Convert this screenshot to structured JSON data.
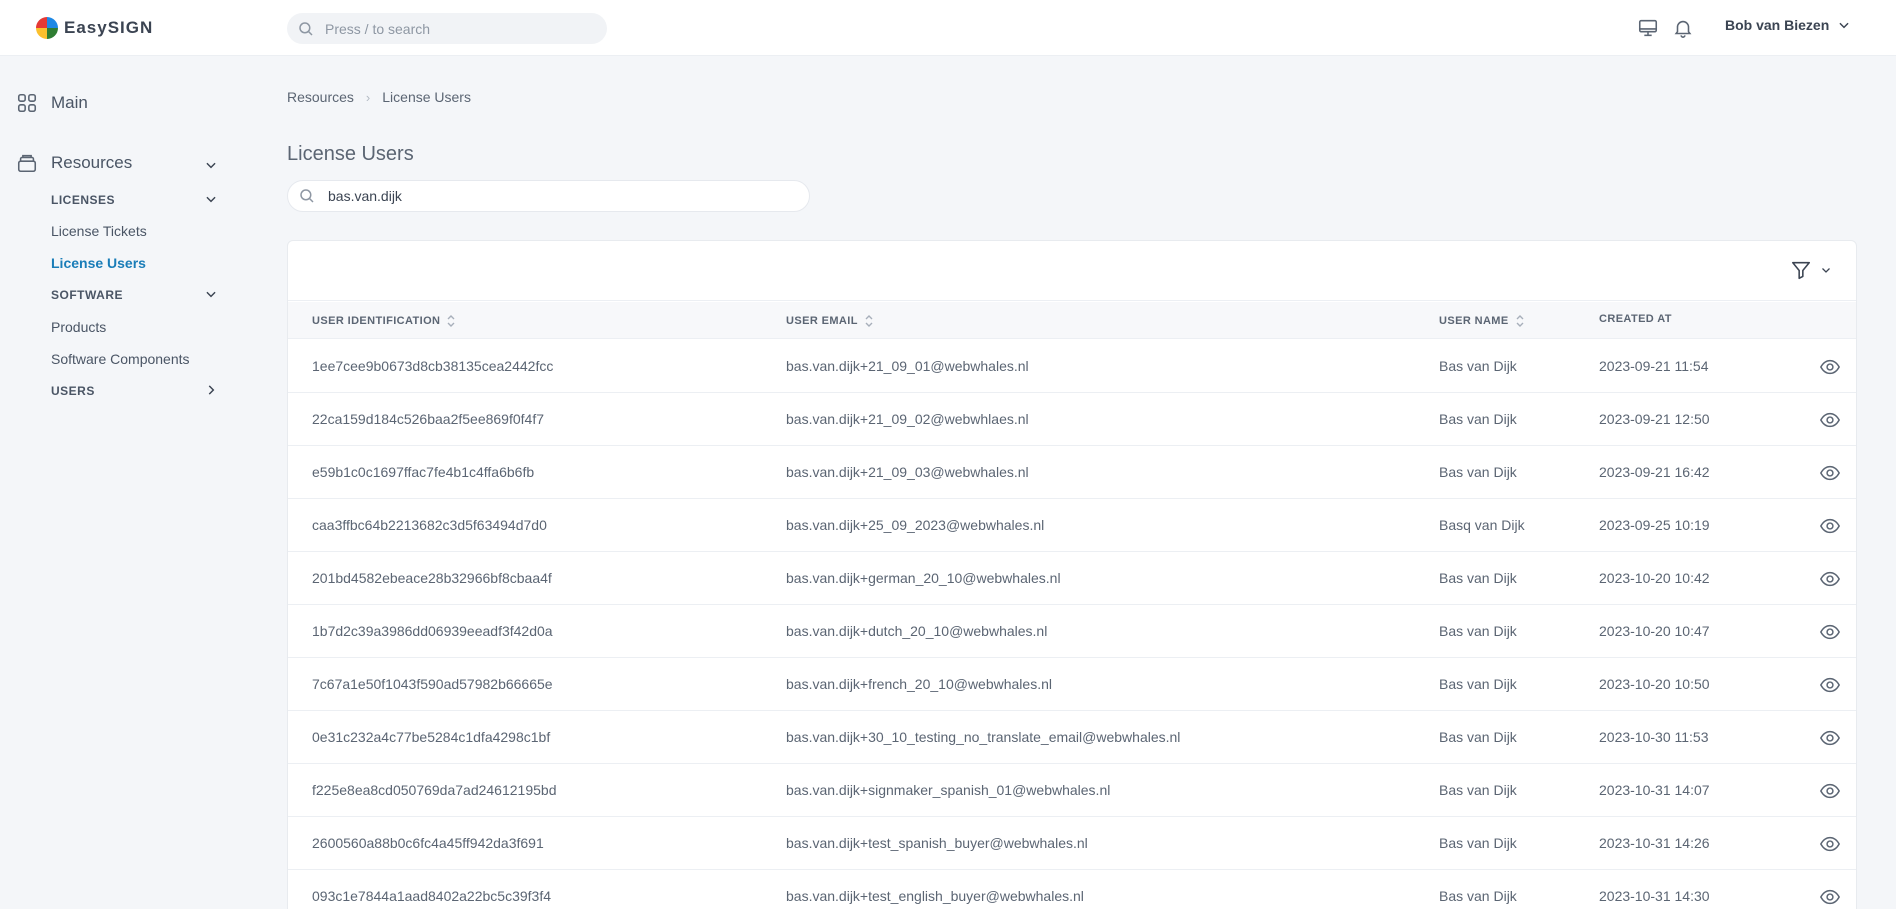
{
  "app": {
    "logo_text": "EasySIGN",
    "search_placeholder": "Press / to search",
    "user_name": "Bob van Biezen"
  },
  "colors": {
    "accent": "#1a7db8",
    "background": "#f4f6f9",
    "text": "#4a5565"
  },
  "sidebar": {
    "main": "Main",
    "resources": "Resources",
    "licenses": "LICENSES",
    "license_tickets": "License Tickets",
    "license_users": "License Users",
    "software": "SOFTWARE",
    "products": "Products",
    "software_components": "Software Components",
    "users": "USERS"
  },
  "breadcrumb": {
    "parent": "Resources",
    "current": "License Users"
  },
  "page": {
    "title": "License Users",
    "search_value": "bas.van.dijk"
  },
  "table": {
    "headers": {
      "id": "USER IDENTIFICATION",
      "email": "USER EMAIL",
      "name": "USER NAME",
      "created": "CREATED AT"
    },
    "rows": [
      {
        "id": "1ee7cee9b0673d8cb38135cea2442fcc",
        "email": "bas.van.dijk+21_09_01@webwhales.nl",
        "name": "Bas van Dijk",
        "created": "2023-09-21 11:54"
      },
      {
        "id": "22ca159d184c526baa2f5ee869f0f4f7",
        "email": "bas.van.dijk+21_09_02@webwhlaes.nl",
        "name": "Bas van Dijk",
        "created": "2023-09-21 12:50"
      },
      {
        "id": "e59b1c0c1697ffac7fe4b1c4ffa6b6fb",
        "email": "bas.van.dijk+21_09_03@webwhales.nl",
        "name": "Bas van Dijk",
        "created": "2023-09-21 16:42"
      },
      {
        "id": "caa3ffbc64b2213682c3d5f63494d7d0",
        "email": "bas.van.dijk+25_09_2023@webwhales.nl",
        "name": "Basq van Dijk",
        "created": "2023-09-25 10:19"
      },
      {
        "id": "201bd4582ebeace28b32966bf8cbaa4f",
        "email": "bas.van.dijk+german_20_10@webwhales.nl",
        "name": "Bas van Dijk",
        "created": "2023-10-20 10:42"
      },
      {
        "id": "1b7d2c39a3986dd06939eeadf3f42d0a",
        "email": "bas.van.dijk+dutch_20_10@webwhales.nl",
        "name": "Bas van Dijk",
        "created": "2023-10-20 10:47"
      },
      {
        "id": "7c67a1e50f1043f590ad57982b66665e",
        "email": "bas.van.dijk+french_20_10@webwhales.nl",
        "name": "Bas van Dijk",
        "created": "2023-10-20 10:50"
      },
      {
        "id": "0e31c232a4c77be5284c1dfa4298c1bf",
        "email": "bas.van.dijk+30_10_testing_no_translate_email@webwhales.nl",
        "name": "Bas van Dijk",
        "created": "2023-10-30 11:53"
      },
      {
        "id": "f225e8ea8cd050769da7ad24612195bd",
        "email": "bas.van.dijk+signmaker_spanish_01@webwhales.nl",
        "name": "Bas van Dijk",
        "created": "2023-10-31 14:07"
      },
      {
        "id": "2600560a88b0c6fc4a45ff942da3f691",
        "email": "bas.van.dijk+test_spanish_buyer@webwhales.nl",
        "name": "Bas van Dijk",
        "created": "2023-10-31 14:26"
      },
      {
        "id": "093c1e7844a1aad8402a22bc5c39f3f4",
        "email": "bas.van.dijk+test_english_buyer@webwhales.nl",
        "name": "Bas van Dijk",
        "created": "2023-10-31 14:30"
      }
    ]
  }
}
